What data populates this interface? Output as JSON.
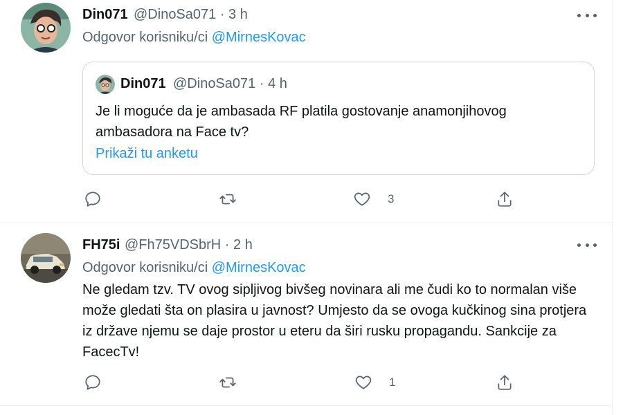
{
  "tweets": [
    {
      "author": "Din071",
      "meta": "@DinoSa071 · 3 h",
      "reply_prefix": "Odgovor korisniku/ci",
      "reply_mention": "@MirnesKovac",
      "quote": {
        "author": "Din071",
        "meta": "@DinoSa071 · 4 h",
        "text": "Je li moguće da je ambasada RF platila gostovanje anamonjihovog ambasadora na Face tv?",
        "link": "Prikaži tu anketu"
      },
      "actions": {
        "like_count": "3"
      }
    },
    {
      "author": "FH75i",
      "meta": "@Fh75VDSbrH · 2 h",
      "reply_prefix": "Odgovor korisniku/ci",
      "reply_mention": "@MirnesKovac",
      "text": "Ne gledam tzv. TV ovog sipljivog bivšeg novinara ali me čudi ko to normalan više može gledati šta on plasira u javnost? Umjesto da se ovoga kučkinog sina protjera iz države njemu se daje prostor u eteru da širi rusku propagandu. Sankcije za FacecTv!",
      "actions": {
        "like_count": "1"
      }
    }
  ],
  "icons": {
    "more": "more-horizontal-icon",
    "reply": "reply-bubble-icon",
    "retweet": "retweet-icon",
    "like": "heart-icon",
    "share": "share-upload-icon"
  },
  "colors": {
    "accent": "#1d9bf0",
    "muted": "#536471",
    "border": "#cfd9de"
  }
}
